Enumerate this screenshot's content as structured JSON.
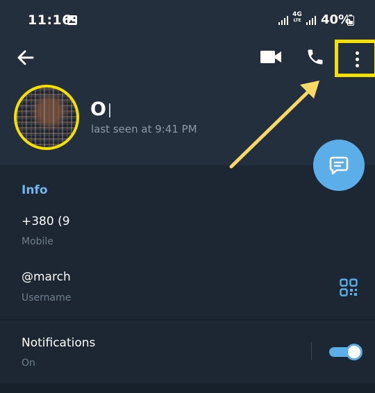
{
  "status_bar": {
    "time": "11:16",
    "network_type": "4G",
    "network_sub": "LTE",
    "battery": "40%"
  },
  "contact": {
    "name": "O",
    "last_seen": "last seen at 9:41 PM"
  },
  "info": {
    "section_title": "Info",
    "phone": "+380 (9",
    "phone_label": "Mobile",
    "username": "@march",
    "username_label": "Username",
    "notifications": "Notifications",
    "notifications_state": "On",
    "notifications_enabled": true
  },
  "colors": {
    "header_bg": "#242f3d",
    "body_bg": "#1d2733",
    "accent": "#5caee8",
    "highlight": "#f4e100",
    "annotation_arrow": "#f7d968"
  },
  "icons": {
    "back": "arrow-left-icon",
    "video": "video-camera-icon",
    "call": "phone-icon",
    "more": "more-vertical-icon",
    "fab": "message-icon",
    "qr": "qr-code-icon"
  }
}
